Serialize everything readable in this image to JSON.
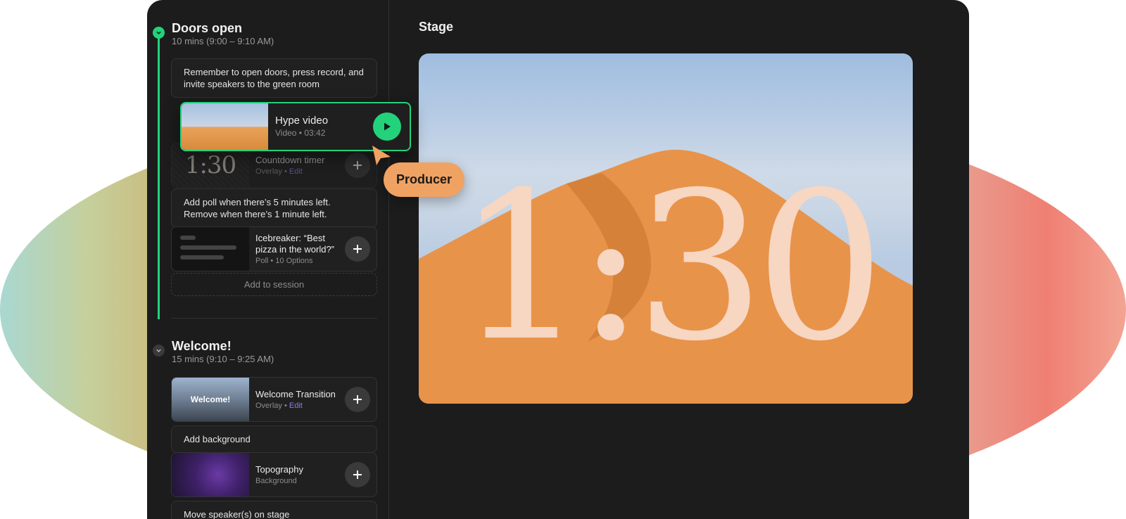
{
  "sessions": [
    {
      "title": "Doors open",
      "subtitle": "10 mins (9:00 – 9:10 AM)",
      "note": "Remember to open doors, press record, and invite speakers to the green room",
      "timer": {
        "thumb_text": "1:30",
        "title": "Countdown timer",
        "type": "Overlay",
        "edit": "Edit"
      },
      "poll_note": "Add poll when there’s 5 minutes left. Remove when there’s 1 minute left.",
      "poll": {
        "title": "Icebreaker: “Best pizza in the world?”",
        "sub": "Poll • 10 Options"
      },
      "add_label": "Add to session"
    },
    {
      "title": "Welcome!",
      "subtitle": "15 mins (9:10 – 9:25 AM)",
      "transition": {
        "thumb_text": "Welcome!",
        "title": "Welcome Transition",
        "type": "Overlay",
        "edit": "Edit"
      },
      "bg_note": "Add background",
      "topo": {
        "title": "Topography",
        "sub": "Background"
      },
      "speaker_note": "Move speaker(s) on stage"
    }
  ],
  "hype": {
    "title": "Hype video",
    "sub": "Video • 03:42"
  },
  "producer_label": "Producer",
  "stage": {
    "title": "Stage",
    "timer": "1:30"
  },
  "colors": {
    "accent": "#22d37c",
    "app_bg": "#1c1c1c",
    "producer": "#f0a262",
    "edit_link": "#8a7cf5"
  }
}
